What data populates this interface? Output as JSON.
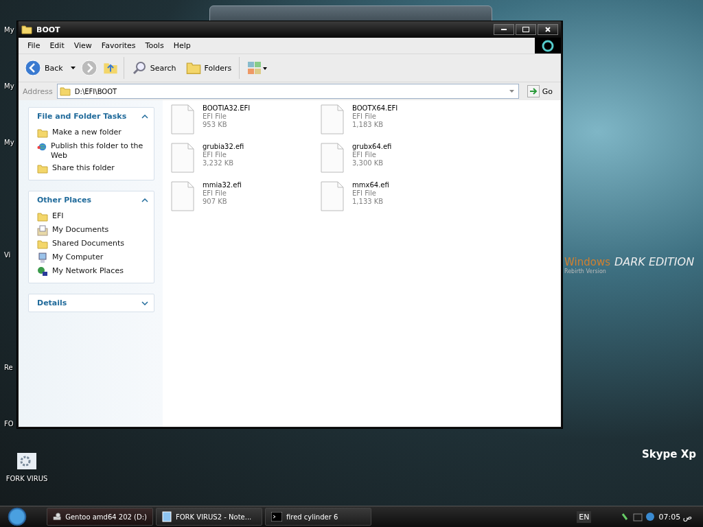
{
  "desktop": {
    "icons": [
      {
        "label": "FORK VIRUS"
      }
    ],
    "cut_labels": [
      "My",
      "My",
      "My",
      "Vi",
      "Re",
      "FO"
    ],
    "wallpaper_texts": [
      "Windows",
      "DARK EDITION",
      "Rebirth Version",
      "Skype Xp"
    ]
  },
  "window": {
    "title": "BOOT",
    "menu": [
      "File",
      "Edit",
      "View",
      "Favorites",
      "Tools",
      "Help"
    ],
    "toolbar": {
      "back": "Back",
      "search": "Search",
      "folders": "Folders"
    },
    "address": {
      "label": "Address",
      "value": "D:\\EFI\\BOOT",
      "go": "Go"
    },
    "panels": [
      {
        "title": "File and Folder Tasks",
        "expanded": true,
        "items": [
          {
            "label": "Make a new folder",
            "kind": "newfolder"
          },
          {
            "label": "Publish this folder to the Web",
            "kind": "web"
          },
          {
            "label": "Share this folder",
            "kind": "share"
          }
        ]
      },
      {
        "title": "Other Places",
        "expanded": true,
        "items": [
          {
            "label": "EFI",
            "kind": "folder"
          },
          {
            "label": "My Documents",
            "kind": "docs"
          },
          {
            "label": "Shared Documents",
            "kind": "folder"
          },
          {
            "label": "My Computer",
            "kind": "computer"
          },
          {
            "label": "My Network Places",
            "kind": "network"
          }
        ]
      },
      {
        "title": "Details",
        "expanded": false
      }
    ],
    "files": [
      {
        "name": "BOOTIA32.EFI",
        "type": "EFI File",
        "size": "953 KB"
      },
      {
        "name": "BOOTX64.EFI",
        "type": "EFI File",
        "size": "1,183 KB"
      },
      {
        "name": "grubia32.efi",
        "type": "EFI File",
        "size": "3,232 KB"
      },
      {
        "name": "grubx64.efi",
        "type": "EFI File",
        "size": "3,300 KB"
      },
      {
        "name": "mmia32.efi",
        "type": "EFI File",
        "size": "907 KB"
      },
      {
        "name": "mmx64.efi",
        "type": "EFI File",
        "size": "1,133 KB"
      }
    ]
  },
  "taskbar": {
    "tasks": [
      {
        "label": "Gentoo amd64 202 (D:)",
        "kind": "drive",
        "selected": true
      },
      {
        "label": "FORK VIRUS2 - Note...",
        "kind": "notepad",
        "selected": false
      },
      {
        "label": "fired cylinder 6",
        "kind": "console",
        "selected": false
      }
    ],
    "language": "EN",
    "clock": "07:05 ص"
  }
}
